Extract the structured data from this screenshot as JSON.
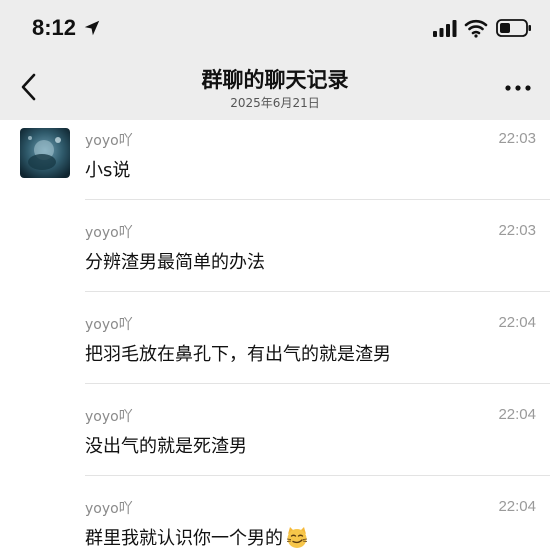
{
  "status_bar": {
    "time": "8:12",
    "icons": [
      "location-arrow-icon",
      "signal-icon",
      "wifi-icon",
      "battery-icon"
    ]
  },
  "nav": {
    "title": "群聊的聊天记录",
    "subtitle": "2025年6月21日",
    "back_icon": "chevron-left-icon",
    "more_icon": "ellipsis-icon"
  },
  "messages": [
    {
      "sender": "yoyo吖",
      "time": "22:03",
      "text": "小s说"
    },
    {
      "sender": "yoyo吖",
      "time": "22:03",
      "text": "分辨渣男最简单的办法"
    },
    {
      "sender": "yoyo吖",
      "time": "22:04",
      "text": "把羽毛放在鼻孔下，有出气的就是渣男"
    },
    {
      "sender": "yoyo吖",
      "time": "22:04",
      "text": "没出气的就是死渣男"
    },
    {
      "sender": "yoyo吖",
      "time": "22:04",
      "text": "群里我就认识你一个男的",
      "emoji": "smirking-cat-emoji"
    }
  ],
  "colors": {
    "header_bg": "#ededed",
    "body_bg": "#ffffff",
    "meta_text": "#8a8a8a",
    "divider": "#e3e3e3"
  }
}
